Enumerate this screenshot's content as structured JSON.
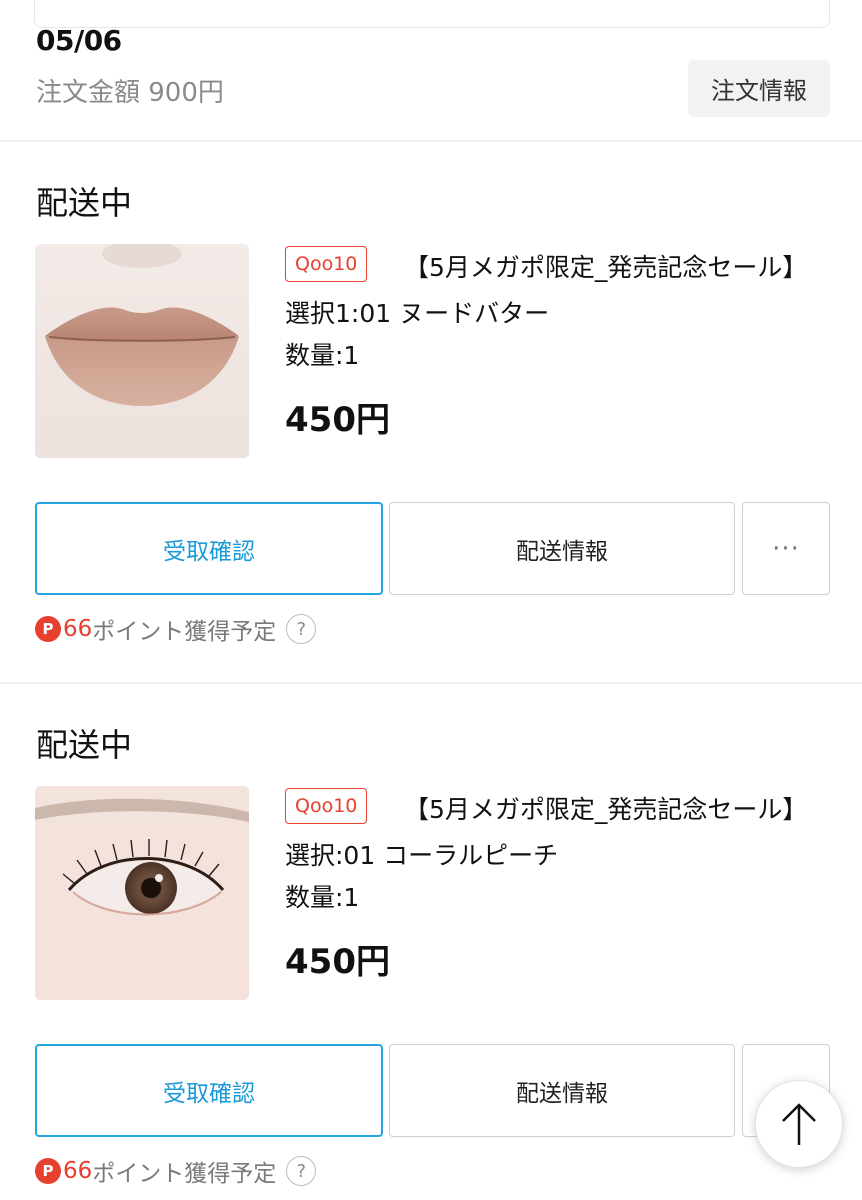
{
  "order": {
    "date": "05/06",
    "amount": "注文金額 900円",
    "info_button": "注文情報"
  },
  "items": [
    {
      "status": "配送中",
      "image": "lips-product-photo",
      "shop_badge": "Qoo10",
      "title": "【5月メガポ限定_発売記念セール】",
      "option": "選択1:01 ヌードバター",
      "quantity": "数量:1",
      "price": "450円",
      "receive_button": "受取確認",
      "shipping_button": "配送情報",
      "more_button": "···",
      "points_icon": "P",
      "points_value": "66",
      "points_text": "ポイント獲得予定",
      "help_icon": "?"
    },
    {
      "status": "配送中",
      "image": "eye-product-photo",
      "shop_badge": "Qoo10",
      "title": "【5月メガポ限定_発売記念セール】",
      "option": "選択:01 コーラルピーチ",
      "quantity": "数量:1",
      "price": "450円",
      "receive_button": "受取確認",
      "shipping_button": "配送情報",
      "more_button": "···",
      "points_icon": "P",
      "points_value": "66",
      "points_text": "ポイント獲得予定",
      "help_icon": "?"
    }
  ],
  "icons": {
    "scroll_top": "arrow-up-icon"
  },
  "colors": {
    "accent_blue": "#1a9ad8",
    "badge_red": "#e8402f"
  }
}
